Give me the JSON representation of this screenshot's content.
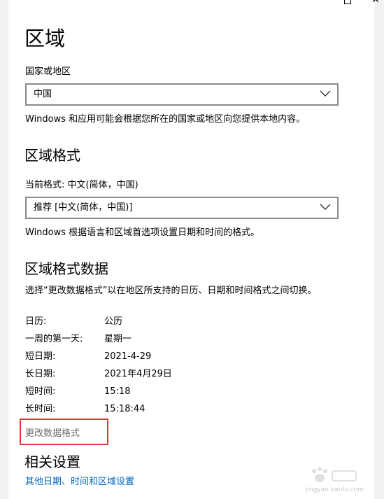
{
  "page": {
    "title": "区域"
  },
  "country": {
    "label": "国家或地区",
    "selected": "中国",
    "description": "Windows 和应用可能会根据您所在的国家或地区向您提供本地内容。"
  },
  "region_format": {
    "title": "区域格式",
    "current_label": "当前格式: 中文(简体，中国)",
    "selected": "推荐 [中文(简体，中国)]",
    "description": "Windows 根据语言和区域首选项设置日期和时间的格式。"
  },
  "format_data": {
    "title": "区域格式数据",
    "description": "选择“更改数据格式”以在地区所支持的日历、日期和时间格式之间切换。",
    "rows": [
      {
        "label": "日历:",
        "value": "公历"
      },
      {
        "label": "一周的第一天:",
        "value": "星期一"
      },
      {
        "label": "短日期:",
        "value": "2021-4-29"
      },
      {
        "label": "长日期:",
        "value": "2021年4月29日"
      },
      {
        "label": "短时间:",
        "value": "15:18"
      },
      {
        "label": "长时间:",
        "value": "15:18:44"
      }
    ],
    "change_link": "更改数据格式"
  },
  "related": {
    "title": "相关设置",
    "link": "其他日期、时间和区域设置"
  },
  "watermark": {
    "text": "jingyan.baidu.com"
  },
  "colors": {
    "link": "#0067c0",
    "highlight": "#e53935",
    "disabled_text": "#6e6e6e"
  }
}
